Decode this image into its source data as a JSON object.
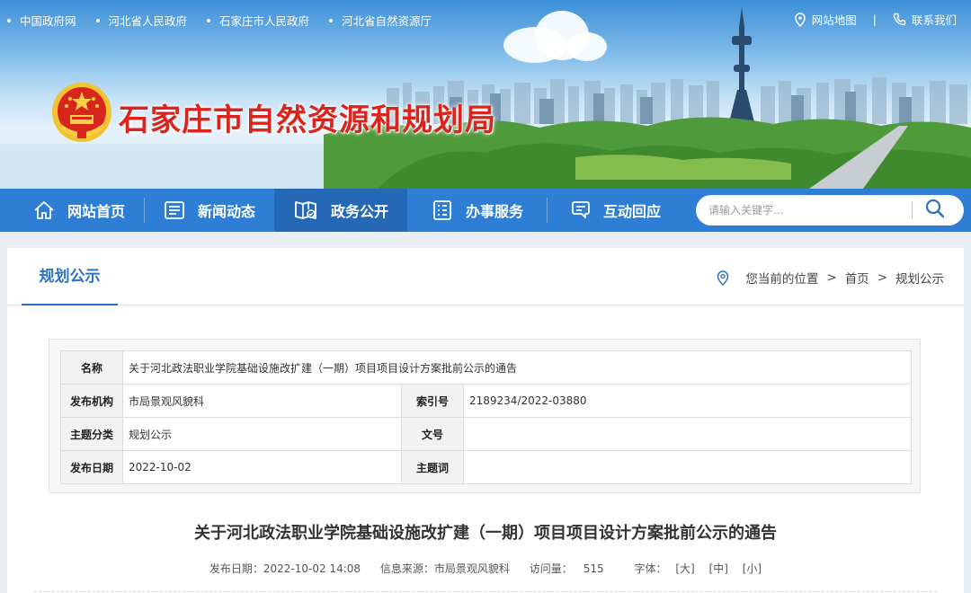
{
  "top_links": [
    "中国政府网",
    "河北省人民政府",
    "石家庄市人民政府",
    "河北省自然资源厅"
  ],
  "top_right": {
    "sitemap": "网站地图",
    "separator": "|",
    "contact": "联系我们"
  },
  "site_title": "石家庄市自然资源和规划局",
  "nav": [
    {
      "label": "网站首页",
      "icon": "home-icon"
    },
    {
      "label": "新闻动态",
      "icon": "news-icon"
    },
    {
      "label": "政务公开",
      "icon": "government-affairs-icon"
    },
    {
      "label": "办事服务",
      "icon": "service-icon"
    },
    {
      "label": "互动回应",
      "icon": "interaction-icon"
    }
  ],
  "nav_active": "政务公开",
  "search": {
    "placeholder": "请输入关键字..."
  },
  "section_title": "规划公示",
  "breadcrumb": {
    "prefix": "您当前的位置",
    "sep": ">",
    "home": "首页",
    "current": "规划公示"
  },
  "info": {
    "name_label": "名称",
    "name_value": "关于河北政法职业学院基础设施改扩建（一期）项目项目设计方案批前公示的通告",
    "org_label": "发布机构",
    "org_value": "市局景观风貌科",
    "index_label": "索引号",
    "index_value": "2189234/2022-03880",
    "topic_class_label": "主题分类",
    "topic_class_value": "规划公示",
    "doc_no_label": "文号",
    "doc_no_value": "",
    "date_label": "发布日期",
    "date_value": "2022-10-02",
    "keyword_label": "主题词",
    "keyword_value": ""
  },
  "article": {
    "title": "关于河北政法职业学院基础设施改扩建（一期）项目项目设计方案批前公示的通告",
    "meta": {
      "date_label": "发布日期：",
      "date": "2022-10-02 14:08",
      "source_label": "信息来源：",
      "source": "市局景观风貌科",
      "views_label": "访问量：",
      "views": "515",
      "font_label": "字体：",
      "font_large": "[大]",
      "font_medium": "[中]",
      "font_small": "[小]"
    }
  },
  "colors": {
    "nav": "#2d7ed4",
    "nav_active": "#2468b6",
    "title_red": "#d9251d",
    "accent_blue": "#2d72c3"
  }
}
